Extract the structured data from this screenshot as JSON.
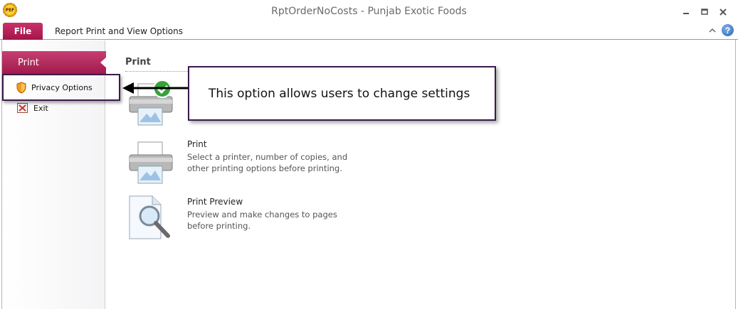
{
  "window": {
    "title": "RptOrderNoCosts  -  Punjab Exotic Foods",
    "app_icon_text": "PEF"
  },
  "ribbon": {
    "file_tab": "File",
    "tabs": [
      {
        "label": "Report Print and View Options"
      }
    ]
  },
  "backstage": {
    "selected_tab": "Print",
    "items": [
      {
        "label": "Privacy Options",
        "icon": "shield-icon"
      },
      {
        "label": "Exit",
        "icon": "exit-icon"
      }
    ]
  },
  "main": {
    "heading": "Print",
    "options": [
      {
        "title": "",
        "description": "",
        "icon": "quick-print-icon"
      },
      {
        "title": "Print",
        "description": "Select a printer, number of copies, and other printing options before printing.",
        "icon": "printer-icon"
      },
      {
        "title": "Print Preview",
        "description": "Preview and make changes to pages before printing.",
        "icon": "print-preview-icon"
      }
    ]
  },
  "annotation": {
    "callout_text": "This option allows users to change settings"
  },
  "colors": {
    "accent": "#b0245a",
    "callout_border": "#3c1a4a",
    "help_blue": "#2a64b8"
  }
}
